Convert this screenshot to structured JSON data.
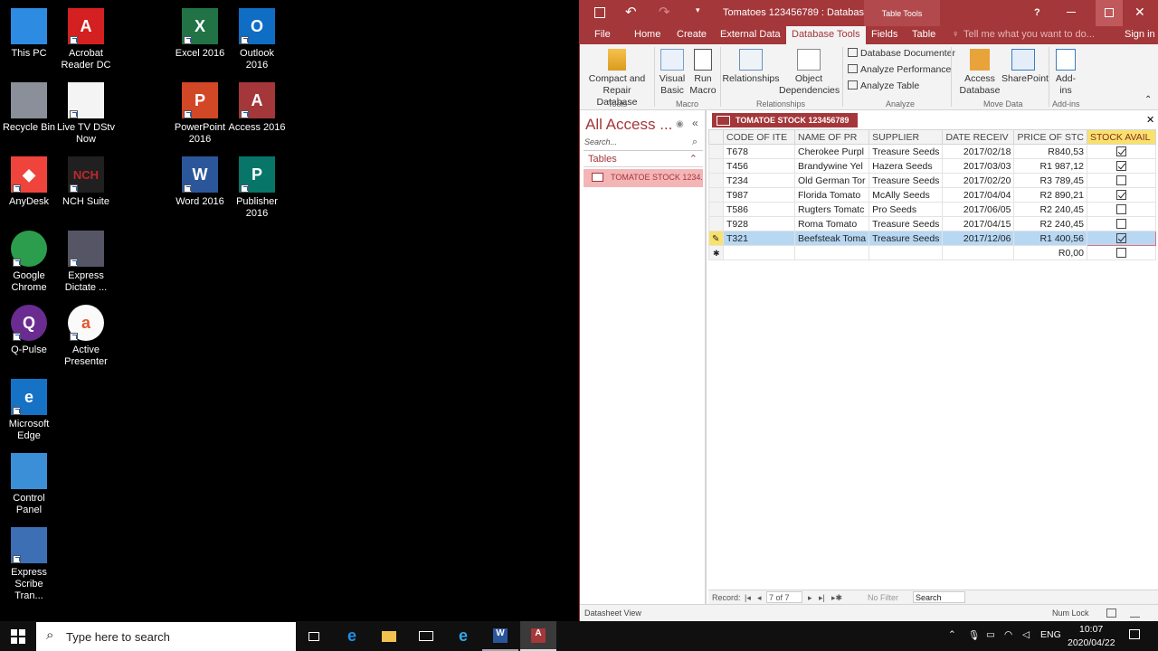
{
  "desktop": {
    "icons": [
      {
        "label": "This PC",
        "icon": "computer-icon"
      },
      {
        "label": "Acrobat Reader DC",
        "icon": "acrobat-icon"
      },
      {
        "label": "Excel 2016",
        "icon": "excel-icon"
      },
      {
        "label": "Outlook 2016",
        "icon": "outlook-icon"
      },
      {
        "label": "Recycle Bin",
        "icon": "recycle-bin-icon"
      },
      {
        "label": "Live TV  DStv Now",
        "icon": "document-icon"
      },
      {
        "label": "PowerPoint 2016",
        "icon": "powerpoint-icon"
      },
      {
        "label": "Access 2016",
        "icon": "access-icon"
      },
      {
        "label": "AnyDesk",
        "icon": "anydesk-icon"
      },
      {
        "label": "NCH Suite",
        "icon": "nch-icon"
      },
      {
        "label": "Word 2016",
        "icon": "word-icon"
      },
      {
        "label": "Publisher 2016",
        "icon": "publisher-icon"
      },
      {
        "label": "Google Chrome",
        "icon": "chrome-icon"
      },
      {
        "label": "Express Dictate ...",
        "icon": "express-dictate-icon"
      },
      {
        "label": "Q-Pulse",
        "icon": "qpulse-icon"
      },
      {
        "label": "Active Presenter",
        "icon": "active-presenter-icon"
      },
      {
        "label": "Microsoft Edge",
        "icon": "edge-icon"
      },
      {
        "label": "Control Panel",
        "icon": "control-panel-icon"
      },
      {
        "label": "Express Scribe Tran...",
        "icon": "express-scribe-icon"
      }
    ]
  },
  "access": {
    "window_title": "Tomatoes 123456789 : Databas...",
    "context_tab": "Table Tools",
    "help": "?",
    "tabs": [
      "File",
      "Home",
      "Create",
      "External Data",
      "Database Tools",
      "Fields",
      "Table"
    ],
    "tell_me": "Tell me what you want to do...",
    "sign_in": "Sign in",
    "ribbon": {
      "compact": "Compact and Repair Database",
      "visual_basic": "Visual Basic",
      "run_macro": "Run Macro",
      "relationships": "Relationships",
      "object_dependencies": "Object Dependencies",
      "db_documenter": "Database Documenter",
      "analyze_performance": "Analyze Performance",
      "analyze_table": "Analyze Table",
      "access_database": "Access Database",
      "sharepoint": "SharePoint",
      "addins": "Add-ins",
      "groups": {
        "tools": "Tools",
        "macro": "Macro",
        "relationships": "Relationships",
        "analyze": "Analyze",
        "move_data": "Move Data",
        "addins": "Add-ins"
      }
    },
    "nav": {
      "title": "All Access ...",
      "search_placeholder": "Search...",
      "section": "Tables",
      "item": "TOMATOE STOCK 1234..."
    },
    "document_tab": "TOMATOE STOCK 123456789",
    "columns": [
      "CODE OF ITE",
      "NAME OF PR",
      "SUPPLIER",
      "DATE RECEIV",
      "PRICE OF STC",
      "STOCK AVAIL"
    ],
    "rows": [
      {
        "code": "T678",
        "name": "Cherokee Purpl",
        "supplier": "Treasure Seeds",
        "date": "2017/02/18",
        "price": "R840,53",
        "avail": true
      },
      {
        "code": "T456",
        "name": "Brandywine Yel",
        "supplier": "Hazera Seeds",
        "date": "2017/03/03",
        "price": "R1 987,12",
        "avail": true
      },
      {
        "code": "T234",
        "name": "Old German Tor",
        "supplier": "Treasure Seeds",
        "date": "2017/02/20",
        "price": "R3 789,45",
        "avail": false
      },
      {
        "code": "T987",
        "name": "Florida Tomato",
        "supplier": "McAlly Seeds",
        "date": "2017/04/04",
        "price": "R2 890,21",
        "avail": true
      },
      {
        "code": "T586",
        "name": "Rugters Tomatc",
        "supplier": "Pro Seeds",
        "date": "2017/06/05",
        "price": "R2 240,45",
        "avail": false
      },
      {
        "code": "T928",
        "name": "Roma Tomato",
        "supplier": "Treasure Seeds",
        "date": "2017/04/15",
        "price": "R2 240,45",
        "avail": false
      },
      {
        "code": "T321",
        "name": "Beefsteak Toma",
        "supplier": "Treasure Seeds",
        "date": "2017/12/06",
        "price": "R1 400,56",
        "avail": true
      }
    ],
    "new_row_price": "R0,00",
    "record_bar": {
      "label": "Record:",
      "position": "7 of 7",
      "filter": "No Filter",
      "search": "Search"
    },
    "status": {
      "view": "Datasheet View",
      "numlock": "Num Lock"
    }
  },
  "taskbar": {
    "search_placeholder": "Type here to search",
    "language": "ENG",
    "time": "10:07",
    "date": "2020/04/22"
  }
}
